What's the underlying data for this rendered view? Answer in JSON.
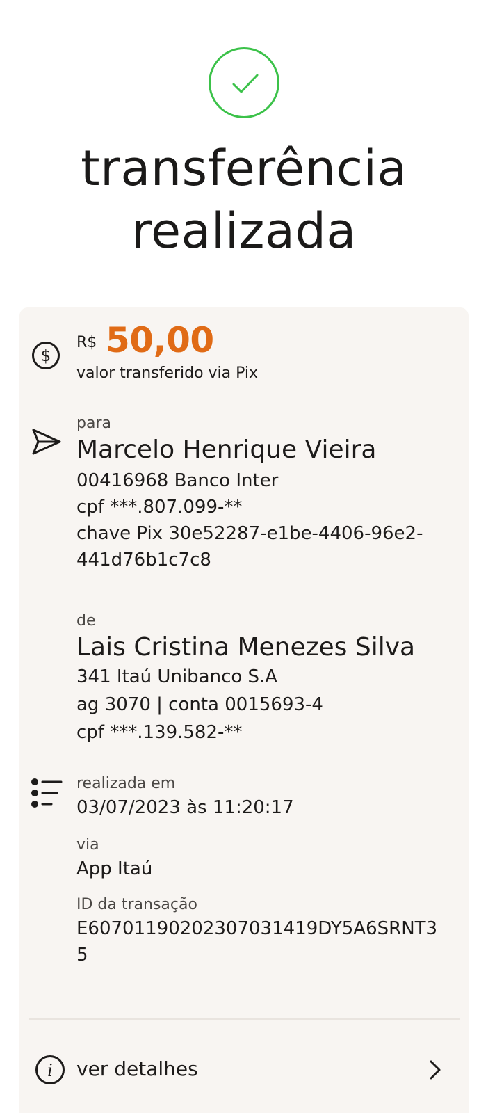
{
  "header": {
    "title_line1": "transferência",
    "title_line2": "realizada",
    "success_icon": "check-circle-icon",
    "accent_color": "#3cc24a"
  },
  "amount": {
    "currency": "R$",
    "value": "50,00",
    "caption": "valor transferido via Pix",
    "icon": "dollar-circle-icon",
    "color": "#e06b16"
  },
  "recipient": {
    "label": "para",
    "name": "Marcelo Henrique Vieira",
    "bank": "00416968 Banco Inter",
    "cpf": "cpf ***.807.099-**",
    "pix_key_line1": "chave Pix 30e52287-e1be-4406-96e2-",
    "pix_key_line2": "441d76b1c7c8",
    "icon": "send-icon"
  },
  "sender": {
    "label": "de",
    "name": "Lais Cristina Menezes Silva",
    "bank": "341 Itaú Unibanco S.A",
    "account": "ag 3070 | conta 0015693-4",
    "cpf": "cpf ***.139.582-**"
  },
  "info": {
    "icon": "list-icon",
    "date_label": "realizada em",
    "date_value": "03/07/2023 às 11:20:17",
    "channel_label": "via",
    "channel_value": "App Itaú",
    "id_label": "ID da transação",
    "id_line1": "E60701190202307031419DY5A6SRNT3",
    "id_line2": "5"
  },
  "details": {
    "label": "ver detalhes",
    "icon": "info-icon",
    "chevron": "chevron-right-icon"
  }
}
